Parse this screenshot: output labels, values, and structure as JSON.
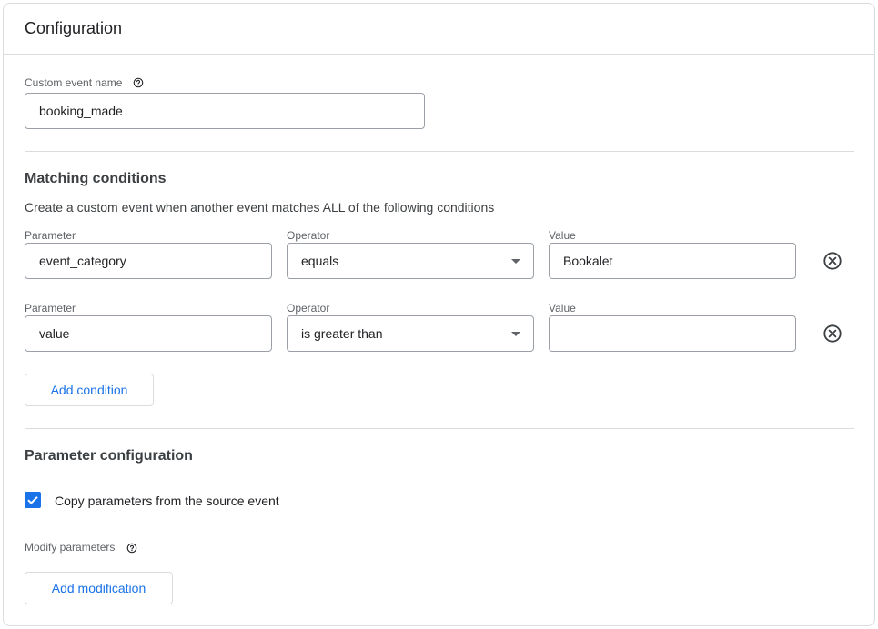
{
  "header": {
    "title": "Configuration"
  },
  "custom_event": {
    "label": "Custom event name",
    "value": "booking_made"
  },
  "matching": {
    "title": "Matching conditions",
    "description": "Create a custom event when another event matches ALL of the following conditions",
    "parameter_label": "Parameter",
    "operator_label": "Operator",
    "value_label": "Value",
    "conditions": [
      {
        "parameter": "event_category",
        "operator": "equals",
        "value": "Bookalet"
      },
      {
        "parameter": "value",
        "operator": "is greater than",
        "value": ""
      }
    ],
    "add_condition_label": "Add condition"
  },
  "parameter_config": {
    "title": "Parameter configuration",
    "copy_label": "Copy parameters from the source event",
    "copy_checked": true,
    "modify_label": "Modify parameters",
    "add_modification_label": "Add modification"
  },
  "colors": {
    "accent": "#1a73e8",
    "border": "#dadce0",
    "input_border": "#9aa0a6"
  }
}
